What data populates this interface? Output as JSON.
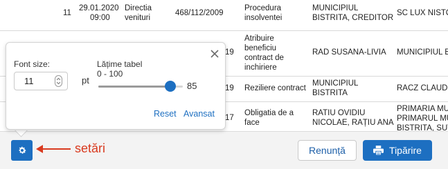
{
  "table": {
    "rows": [
      {
        "nr": "11",
        "date": "29.01.2020",
        "time": "09:00",
        "dept": [
          "Directia",
          "venituri"
        ],
        "ref": "468/112/2009",
        "obj": [
          "Procedura",
          "insolventei"
        ],
        "party1": [
          "MUNICIPIUL",
          "BISTRITA, CREDITOR"
        ],
        "party2": [
          "SC LUX NISTO"
        ]
      },
      {
        "nr": "",
        "date": "",
        "time": "",
        "dept": [],
        "ref": "",
        "partial": "19",
        "obj": [
          "Atribuire",
          "beneficiu",
          "contract de",
          "inchiriere"
        ],
        "party1": [
          "RAD SUSANA-LIVIA"
        ],
        "party2": [
          "MUNICIPIUL B"
        ]
      },
      {
        "nr": "",
        "date": "",
        "time": "",
        "dept": [],
        "ref": "",
        "partial": "19",
        "obj": [
          "Reziliere contract"
        ],
        "party1": [
          "MUNICIPIUL",
          "BISTRITA"
        ],
        "party2": [
          "RACZ CLAUDIA"
        ]
      },
      {
        "nr": "",
        "date": "",
        "time": "",
        "dept": [],
        "ref": "",
        "partial": "17",
        "obj": [
          "Obligatia de a",
          "face"
        ],
        "party1": [
          "RATIU OVIDIU",
          "NICOLAE, RAȚIU ANA"
        ],
        "party2": [
          "PRIMARIA MU",
          "PRIMARUL MU",
          "BISTRITA, SUT"
        ]
      }
    ]
  },
  "popover": {
    "font_size_label": "Font size:",
    "font_size_value": "11",
    "font_size_unit": "pt",
    "width_label": "Lățime tabel",
    "width_range": "0 - 100",
    "width_value": "85",
    "width_level": 85,
    "reset_label": "Reset",
    "advanced_label": "Avansat"
  },
  "footer": {
    "settings_annotation": "setări",
    "cancel_label": "Renunță",
    "print_label": "Tipărire"
  },
  "colors": {
    "accent": "#1d6fc1",
    "annotation": "#d93a1f"
  },
  "icons": {
    "settings": "gear-icon",
    "print": "printer-icon",
    "close": "close-icon",
    "annotation": "arrow-left-icon"
  }
}
